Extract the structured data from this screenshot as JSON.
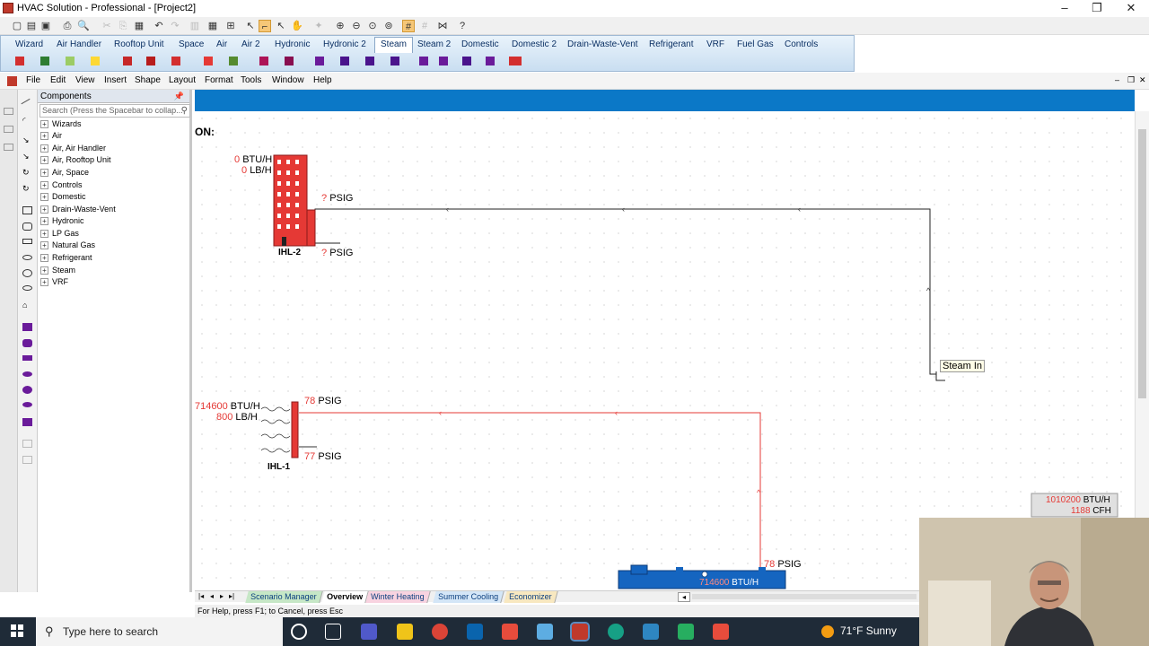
{
  "window": {
    "title": "HVAC Solution - Professional - [Project2]",
    "controls": [
      "–",
      "❐",
      "✕"
    ]
  },
  "categories": [
    {
      "label": "Wizard",
      "active": false
    },
    {
      "label": "Air Handler",
      "active": false
    },
    {
      "label": "Rooftop Unit",
      "active": false
    },
    {
      "label": "Space",
      "active": false
    },
    {
      "label": "Air",
      "active": false
    },
    {
      "label": "Air 2",
      "active": false
    },
    {
      "label": "Hydronic",
      "active": false
    },
    {
      "label": "Hydronic 2",
      "active": false
    },
    {
      "label": "Steam",
      "active": true
    },
    {
      "label": "Steam 2",
      "active": false
    },
    {
      "label": "Domestic",
      "active": false
    },
    {
      "label": "Domestic 2",
      "active": false
    },
    {
      "label": "Drain-Waste-Vent",
      "active": false
    },
    {
      "label": "Refrigerant",
      "active": false
    },
    {
      "label": "VRF",
      "active": false
    },
    {
      "label": "Fuel Gas",
      "active": false
    },
    {
      "label": "Controls",
      "active": false
    }
  ],
  "menu": [
    "File",
    "Edit",
    "View",
    "Insert",
    "Shape",
    "Layout",
    "Format",
    "Tools",
    "Window",
    "Help"
  ],
  "components": {
    "title": "Components",
    "search_placeholder": "Search (Press the Spacebar to collap...",
    "items": [
      "Wizards",
      "Air",
      "Air, Air Handler",
      "Air, Rooftop Unit",
      "Air, Space",
      "Controls",
      "Domestic",
      "Drain-Waste-Vent",
      "Hydronic",
      "LP Gas",
      "Natural Gas",
      "Refrigerant",
      "Steam",
      "VRF"
    ]
  },
  "canvas": {
    "heading_fragment": "ON:",
    "ihl2": {
      "name": "IHL-2",
      "btuh": "0",
      "btuh_unit": "BTU/H",
      "lbh": "0",
      "lbh_unit": "LB/H",
      "psig_top": "?",
      "psig_bottom": "?",
      "psig_unit": "PSIG"
    },
    "ihl1": {
      "name": "IHL-1",
      "btuh": "714600",
      "btuh_unit": "BTU/H",
      "lbh": "800",
      "lbh_unit": "LB/H",
      "psig_top": "78",
      "psig_bottom": "77",
      "psig_unit": "PSIG"
    },
    "steam_in_label": "Steam In",
    "boiler": {
      "btuh": "714600",
      "btuh_unit": "BTU/H",
      "psig": "78",
      "psig_unit": "PSIG"
    },
    "summary": {
      "btuh": "1010200",
      "btuh_unit": "BTU/H",
      "cfh": "1188",
      "cfh_unit": "CFH"
    }
  },
  "sheets": [
    "Scenario Manager",
    "Overview",
    "Winter Heating",
    "Summer Cooling",
    "Economizer"
  ],
  "active_sheet": "Overview",
  "status": "For Help, press F1; to Cancel, press Esc",
  "taskbar": {
    "search_placeholder": "Type here to search",
    "weather": "71°F  Sunny"
  },
  "colors": {
    "accent": "#0b78c7",
    "steam_red": "#e53935",
    "equipment_blue": "#1565c0"
  }
}
